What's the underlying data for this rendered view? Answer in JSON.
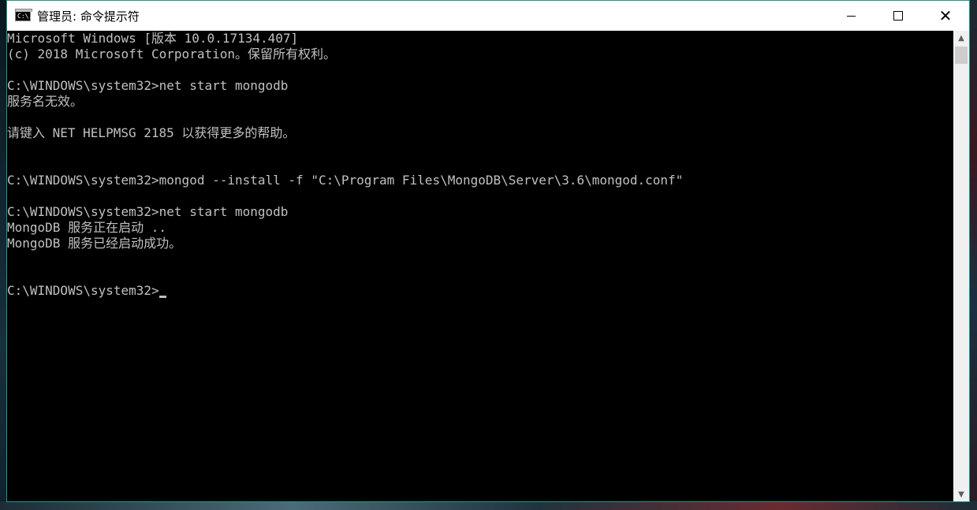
{
  "window": {
    "title": "管理员: 命令提示符",
    "icon_text": "C:\\.",
    "controls": {
      "minimize": "minimize-icon",
      "maximize": "maximize-icon",
      "close": "✕"
    },
    "border_color": "#1c9a8c"
  },
  "console": {
    "lines": [
      "Microsoft Windows [版本 10.0.17134.407]",
      "(c) 2018 Microsoft Corporation。保留所有权利。",
      "",
      "C:\\WINDOWS\\system32>net start mongodb",
      "服务名无效。",
      "",
      "请键入 NET HELPMSG 2185 以获得更多的帮助。",
      "",
      "",
      "C:\\WINDOWS\\system32>mongod --install -f \"C:\\Program Files\\MongoDB\\Server\\3.6\\mongod.conf\"",
      "",
      "C:\\WINDOWS\\system32>net start mongodb",
      "MongoDB 服务正在启动 ..",
      "MongoDB 服务已经启动成功。",
      "",
      "",
      "C:\\WINDOWS\\system32>"
    ],
    "text_color": "#c0c0c0",
    "background": "#000000"
  },
  "scrollbar": {
    "up_icon": "▲",
    "down_icon": "▼"
  }
}
